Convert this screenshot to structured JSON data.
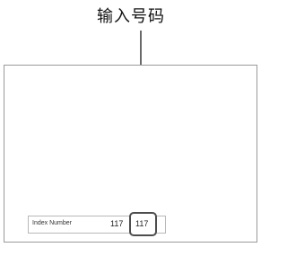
{
  "callout": {
    "label": "输入号码"
  },
  "index_field": {
    "label": "Index Number",
    "value": "117",
    "input_value": "117"
  }
}
